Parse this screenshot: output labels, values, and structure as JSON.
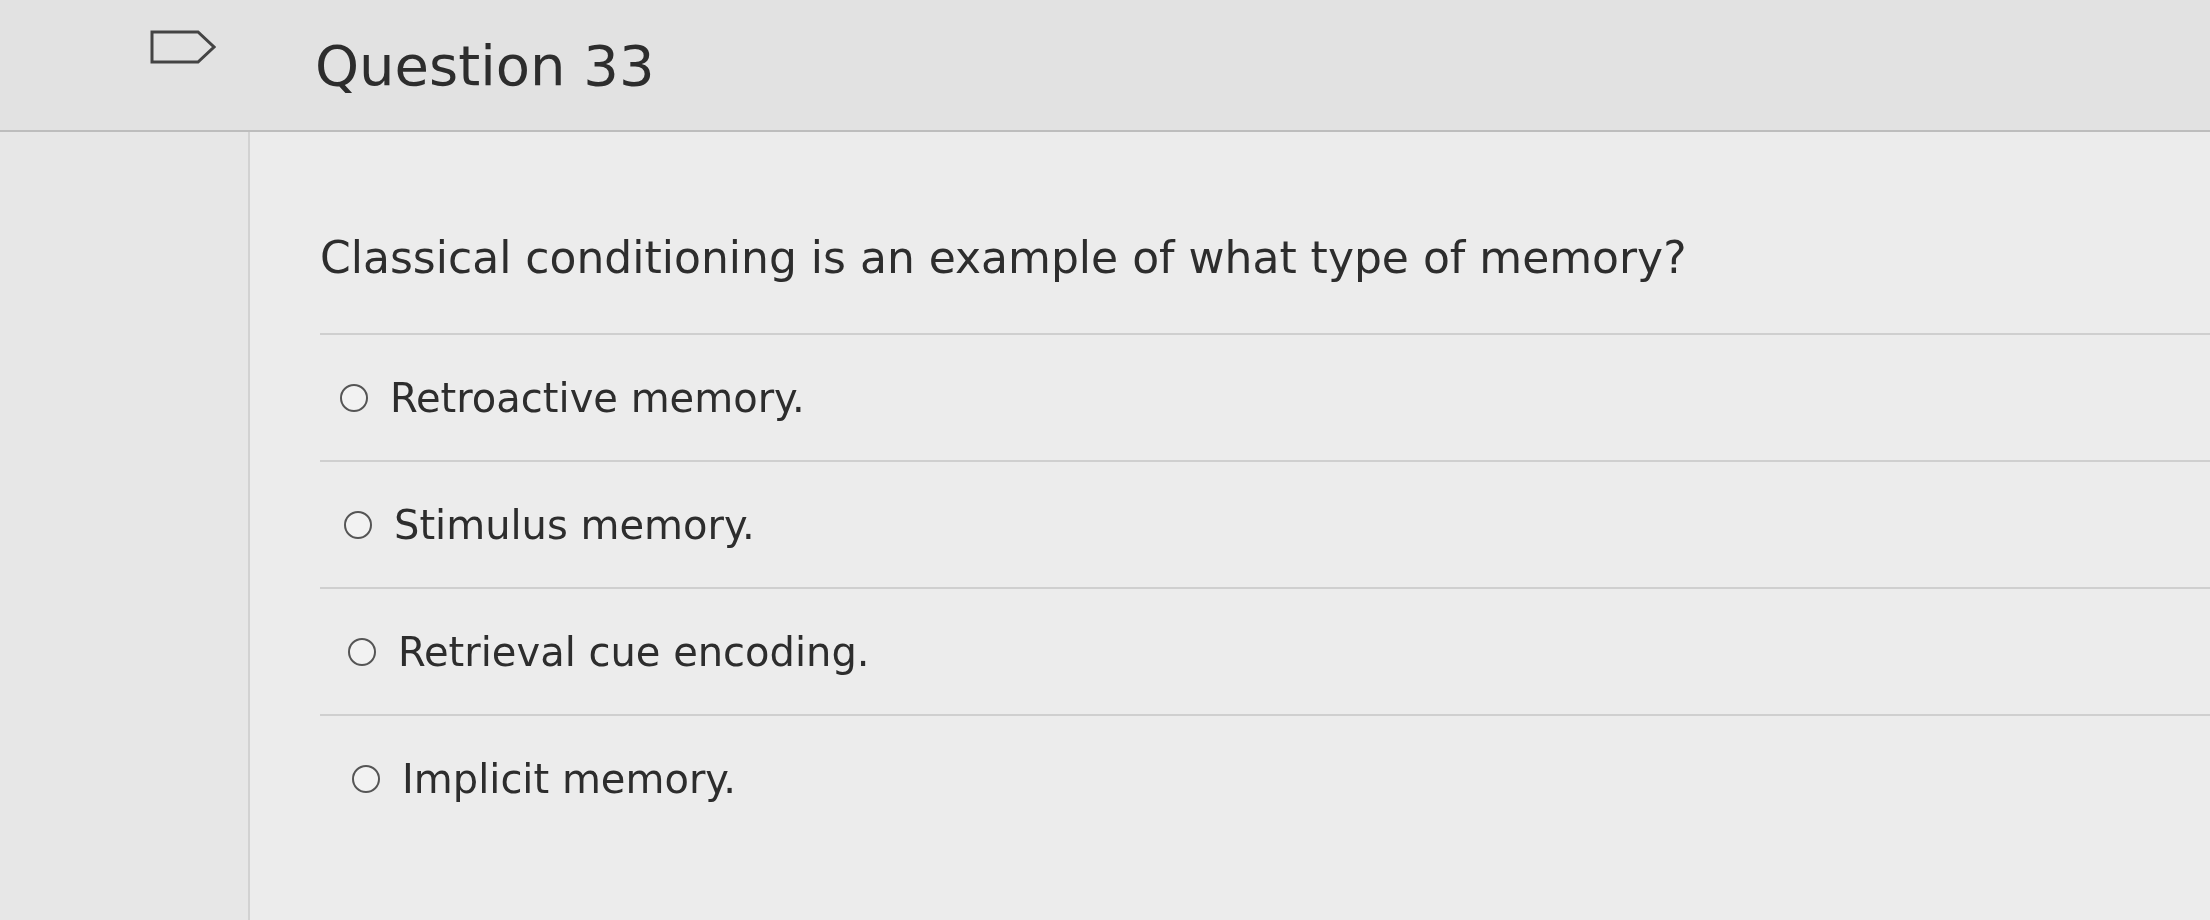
{
  "question": {
    "title": "Question 33",
    "text": "Classical conditioning is an example of what type of memory?",
    "options": [
      {
        "label": "Retroactive memory.",
        "selected": false
      },
      {
        "label": "Stimulus memory.",
        "selected": false
      },
      {
        "label": "Retrieval cue encoding.",
        "selected": false
      },
      {
        "label": "Implicit memory.",
        "selected": false
      }
    ]
  }
}
